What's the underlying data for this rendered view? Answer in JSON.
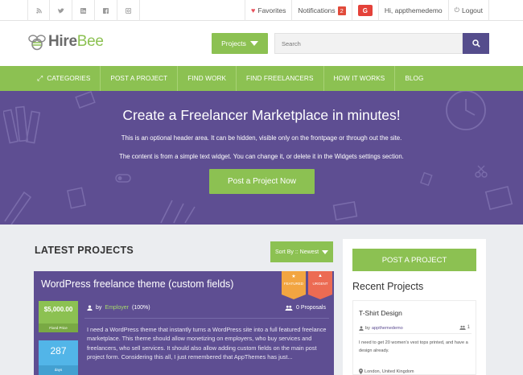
{
  "topbar": {
    "social_icons": [
      "rss-icon",
      "twitter-icon",
      "linkedin-icon",
      "facebook-icon",
      "instagram-icon"
    ],
    "favorites": "Favorites",
    "notifications": "Notifications",
    "notifications_count": "2",
    "greeting": "Hi, appthemedemo",
    "logout": "Logout"
  },
  "header": {
    "logo_hire": "Hire",
    "logo_bee": "Bee",
    "projects_dropdown": "Projects",
    "search_placeholder": "Search"
  },
  "nav": {
    "items": [
      "CATEGORIES",
      "POST A PROJECT",
      "FIND WORK",
      "FIND FREELANCERS",
      "HOW IT WORKS",
      "BLOG"
    ]
  },
  "hero": {
    "title": "Create a Freelancer Marketplace in minutes!",
    "text1": "This is an optional header area. It can be hidden, visible only on the frontpage or through out the site.",
    "text2": "The content is from a simple text widget. You can change it, or delete it in the Widgets settings section.",
    "button": "Post a Project Now"
  },
  "latest": {
    "title": "LATEST PROJECTS",
    "sort_label": "Sort By :: Newest"
  },
  "project": {
    "title": "WordPress freelance theme (custom fields)",
    "featured": "FEATURED",
    "urgent": "URGENT",
    "price": "$5,000.00",
    "price_type": "Fixed Price",
    "days": "287",
    "days_label": "days",
    "by": "by",
    "employer": "Employer",
    "rating": "(100%)",
    "proposals": "0 Proposals",
    "description": "I need a WordPress theme that instantly turns a WordPress site into a full featured freelance marketplace. This theme should allow monetizing on employers, who buy services and freelancers, who sell services. It should also allow adding custom fields on the main post project form. Considering this all, I just remembered that AppThemes has just..."
  },
  "sidebar": {
    "post_button": "POST A PROJECT",
    "recent_title": "Recent Projects",
    "recent": {
      "title": "T-Shirt Design",
      "by": "by",
      "user": "appthemedemo",
      "count": "1",
      "description": "I need to get 20 women's vest tops printed, and have a design already.",
      "location": "London, United Kingdom"
    }
  },
  "colors": {
    "accent_green": "#8cc152",
    "brand_purple": "#5e4e92",
    "featured_orange": "#f2a541",
    "urgent_red": "#ec6b53",
    "days_blue": "#52b5e8"
  }
}
